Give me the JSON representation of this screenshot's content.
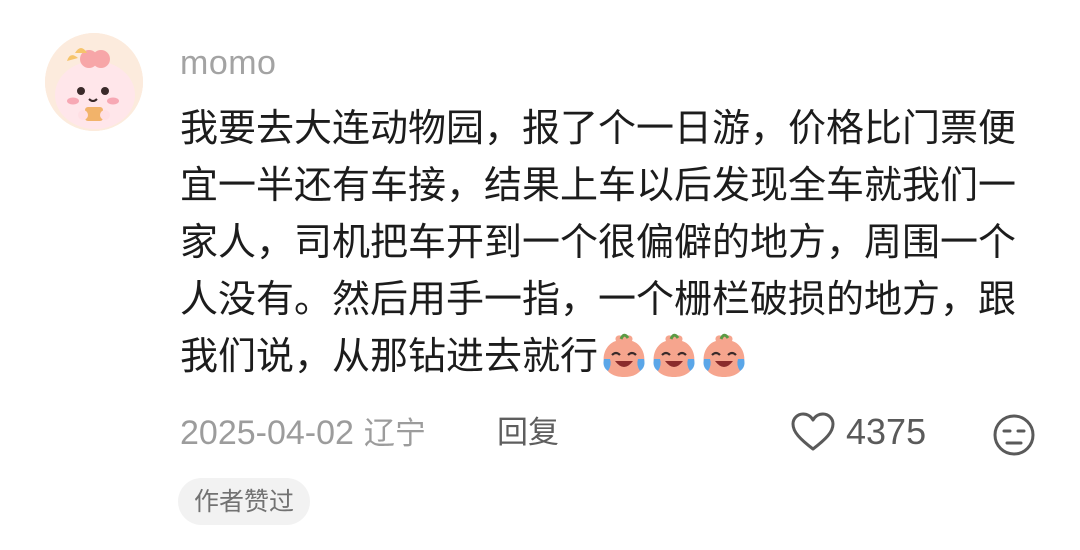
{
  "comment": {
    "username": "momo",
    "text": "我要去大连动物园，报了个一日游，价格比门票便宜一半还有车接，结果上车以后发现全车就我们一家人，司机把车开到一个很偏僻的地方，周围一个人没有。然后用手一指，一个栅栏破损的地方，跟我们说，从那钻进去就行",
    "emojis": [
      "crying-laughing-peach-emoji",
      "crying-laughing-peach-emoji",
      "crying-laughing-peach-emoji"
    ],
    "date": "2025-04-02",
    "location": "辽宁",
    "reply_label": "回复",
    "like_count": "4375",
    "badge": "作者赞过"
  },
  "icons": {
    "avatar": "cartoon-peach-avatar",
    "like": "heart-outline-icon",
    "dislike": "meh-face-icon"
  },
  "colors": {
    "username": "#a3a3a3",
    "text": "#1c1c1c",
    "meta": "#9c9c9c",
    "badge_bg": "#f2f2f2",
    "emoji_peach": "#f6a58e",
    "emoji_tear": "#5aa6e8"
  }
}
